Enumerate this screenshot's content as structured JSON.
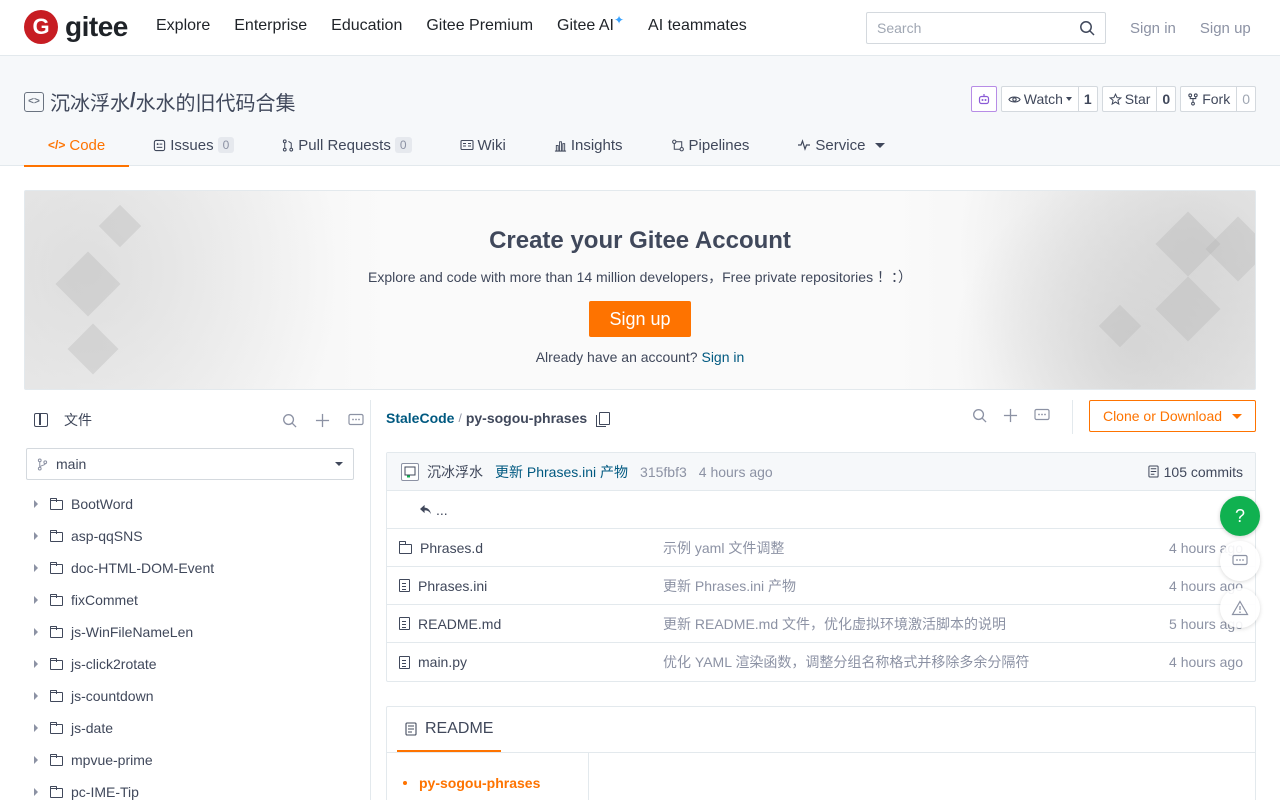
{
  "header": {
    "logo_mark": "G",
    "logo_text": "gitee",
    "nav": [
      "Explore",
      "Enterprise",
      "Education",
      "Gitee Premium",
      "Gitee AI",
      "AI teammates"
    ],
    "ai_star": "✦",
    "search_placeholder": "Search",
    "sign_in": "Sign in",
    "sign_up": "Sign up"
  },
  "repo": {
    "owner": "沉冰浮水",
    "separator": "/",
    "name": "水水的旧代码合集",
    "watch": {
      "label": "Watch",
      "count": "1"
    },
    "star": {
      "label": "Star",
      "count": "0"
    },
    "fork": {
      "label": "Fork",
      "count": "0"
    }
  },
  "tabs": [
    {
      "label": "Code",
      "badge": ""
    },
    {
      "label": "Issues",
      "badge": "0"
    },
    {
      "label": "Pull Requests",
      "badge": "0"
    },
    {
      "label": "Wiki",
      "badge": ""
    },
    {
      "label": "Insights",
      "badge": ""
    },
    {
      "label": "Pipelines",
      "badge": ""
    },
    {
      "label": "Service",
      "badge": ""
    }
  ],
  "banner": {
    "title": "Create your Gitee Account",
    "subtitle": "Explore and code with more than 14 million developers，Free private repositories ！：）",
    "signup_label": "Sign up",
    "already_text": "Already have an account?",
    "signin_link": "Sign in"
  },
  "sidebar": {
    "title": "文件",
    "branch": "main",
    "tree": [
      "BootWord",
      "asp-qqSNS",
      "doc-HTML-DOM-Event",
      "fixCommet",
      "js-WinFileNameLen",
      "js-click2rotate",
      "js-countdown",
      "js-date",
      "mpvue-prime",
      "pc-IME-Tip"
    ]
  },
  "main": {
    "breadcrumb_owner": "StaleCode",
    "breadcrumb_sep": "/",
    "breadcrumb_current": "py-sogou-phrases",
    "clone_label": "Clone or Download",
    "commit": {
      "author": "沉冰浮水",
      "message": "更新 Phrases.ini 产物",
      "sha": "315fbf3",
      "time": "4 hours ago",
      "commits": "105 commits"
    },
    "up_label": "...",
    "files": [
      {
        "name": "Phrases.d",
        "type": "folder",
        "message": "示例 yaml 文件调整",
        "time": "4 hours ago"
      },
      {
        "name": "Phrases.ini",
        "type": "file",
        "message": "更新 Phrases.ini 产物",
        "time": "4 hours ago"
      },
      {
        "name": "README.md",
        "type": "file",
        "message": "更新 README.md 文件，优化虚拟环境激活脚本的说明",
        "time": "5 hours ago"
      },
      {
        "name": "main.py",
        "type": "file",
        "message": "优化 YAML 渲染函数，调整分组名称格式并移除多余分隔符",
        "time": "4 hours ago"
      }
    ]
  },
  "readme": {
    "tab_label": "README",
    "toc_item": "py-sogou-phrases"
  },
  "fab": {
    "help": "?"
  }
}
